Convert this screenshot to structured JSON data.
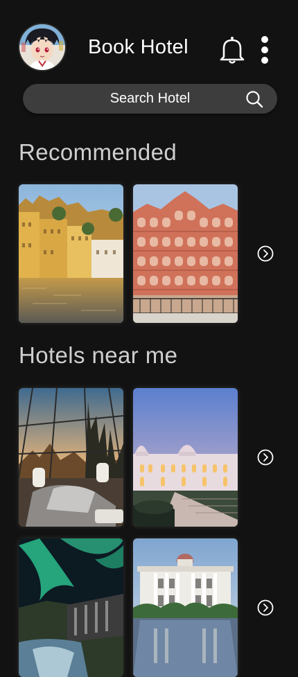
{
  "header": {
    "title": "Book Hotel",
    "avatar_icon": "avatar",
    "notification_icon": "bell-icon",
    "menu_icon": "more-vertical-icon"
  },
  "search": {
    "label": "Search Hotel",
    "icon": "search-icon",
    "bar_color": "#3d3d3d"
  },
  "sections": {
    "recommended": {
      "title": "Recommended",
      "next_icon": "chevron-right-circle-icon"
    },
    "nearby": {
      "title": "Hotels near me",
      "next_icon": "chevron-right-circle-icon"
    }
  },
  "theme": {
    "background": "#121212",
    "text_primary": "#ffffff",
    "text_section": "#cfcfcf"
  }
}
